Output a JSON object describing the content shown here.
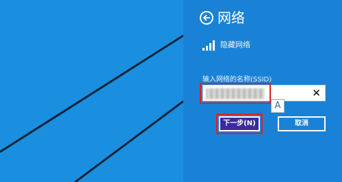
{
  "panel": {
    "title": "网络",
    "hidden_network_label": "隐藏网络",
    "ssid_label": "输入网络的名称(SSID)",
    "ssid_value": "",
    "clear_glyph": "✕",
    "ime_indicator": "A",
    "next_button": "下一步(N)",
    "cancel_button": "取消"
  },
  "colors": {
    "desktop_bg": "#1a8fe0",
    "panel_bg": "#1a82d6",
    "next_button_bg": "#3c2b9a",
    "highlight": "#e02020"
  },
  "icons": [
    "back-arrow-icon",
    "wifi-signal-icon",
    "clear-icon"
  ]
}
